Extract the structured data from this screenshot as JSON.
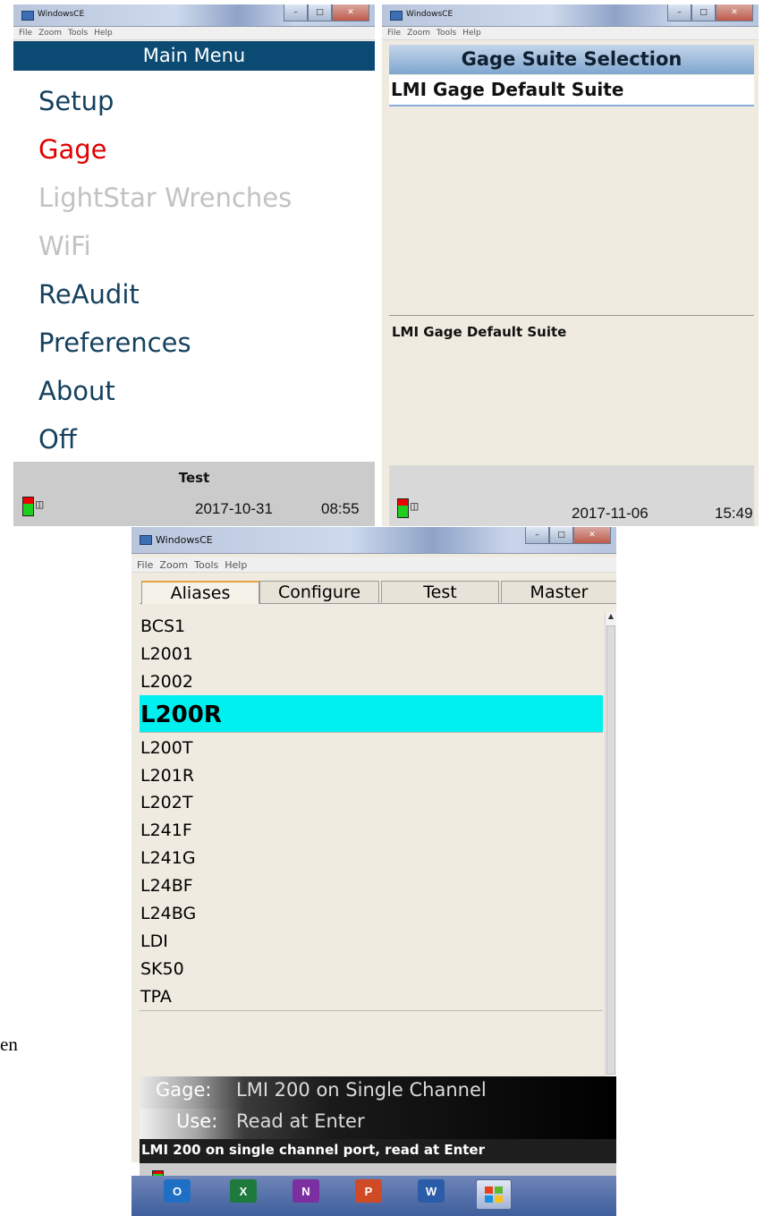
{
  "window1": {
    "title": "WindowsCE",
    "menu": [
      "File",
      "Zoom",
      "Tools",
      "Help"
    ],
    "header": "Main Menu",
    "items": [
      {
        "label": "Setup",
        "color": "#15415f"
      },
      {
        "label": "Gage",
        "color": "#e00000"
      },
      {
        "label": "LightStar Wrenches",
        "color": "#c2c2c2"
      },
      {
        "label": "WiFi",
        "color": "#c2c2c2"
      },
      {
        "label": "ReAudit",
        "color": "#15415f"
      },
      {
        "label": "Preferences",
        "color": "#15415f"
      },
      {
        "label": "About",
        "color": "#15415f"
      },
      {
        "label": "Off",
        "color": "#15415f"
      }
    ],
    "status_text": "Test",
    "date": "2017-10-31",
    "time": "08:55"
  },
  "window2": {
    "title": "WindowsCE",
    "menu": [
      "File",
      "Zoom",
      "Tools",
      "Help"
    ],
    "header": "Gage Suite Selection",
    "selected_item": "LMI Gage Default Suite",
    "description": "LMI Gage Default Suite",
    "date": "2017-11-06",
    "time": "15:49"
  },
  "window3": {
    "title": "WindowsCE",
    "menu": [
      "File",
      "Zoom",
      "Tools",
      "Help"
    ],
    "tabs": [
      "Aliases",
      "Configure",
      "Test",
      "Master"
    ],
    "list": [
      "BCS1",
      "L2001",
      "L2002",
      "L200R",
      "L200T",
      "L201R",
      "L202T",
      "L241F",
      "L241G",
      "L24BF",
      "L24BG",
      "LDI",
      "SK50",
      "TPA"
    ],
    "selected_index": 3,
    "gage_label": "Gage:",
    "gage_value": "LMI 200 on Single Channel",
    "use_label": "Use:",
    "use_value": "Read at Enter",
    "info": "LMI 200 on single channel port, read at Enter"
  },
  "margin_text": "en",
  "taskbar": {
    "apps": [
      {
        "name": "outlook-icon",
        "label": "O",
        "color": "#1f6fc5"
      },
      {
        "name": "excel-icon",
        "label": "X",
        "color": "#1e7a3c"
      },
      {
        "name": "onenote-icon",
        "label": "N",
        "color": "#7b2fa0"
      },
      {
        "name": "powerpoint-icon",
        "label": "P",
        "color": "#d04a25"
      },
      {
        "name": "word-icon",
        "label": "W",
        "color": "#2a5caa"
      }
    ]
  }
}
